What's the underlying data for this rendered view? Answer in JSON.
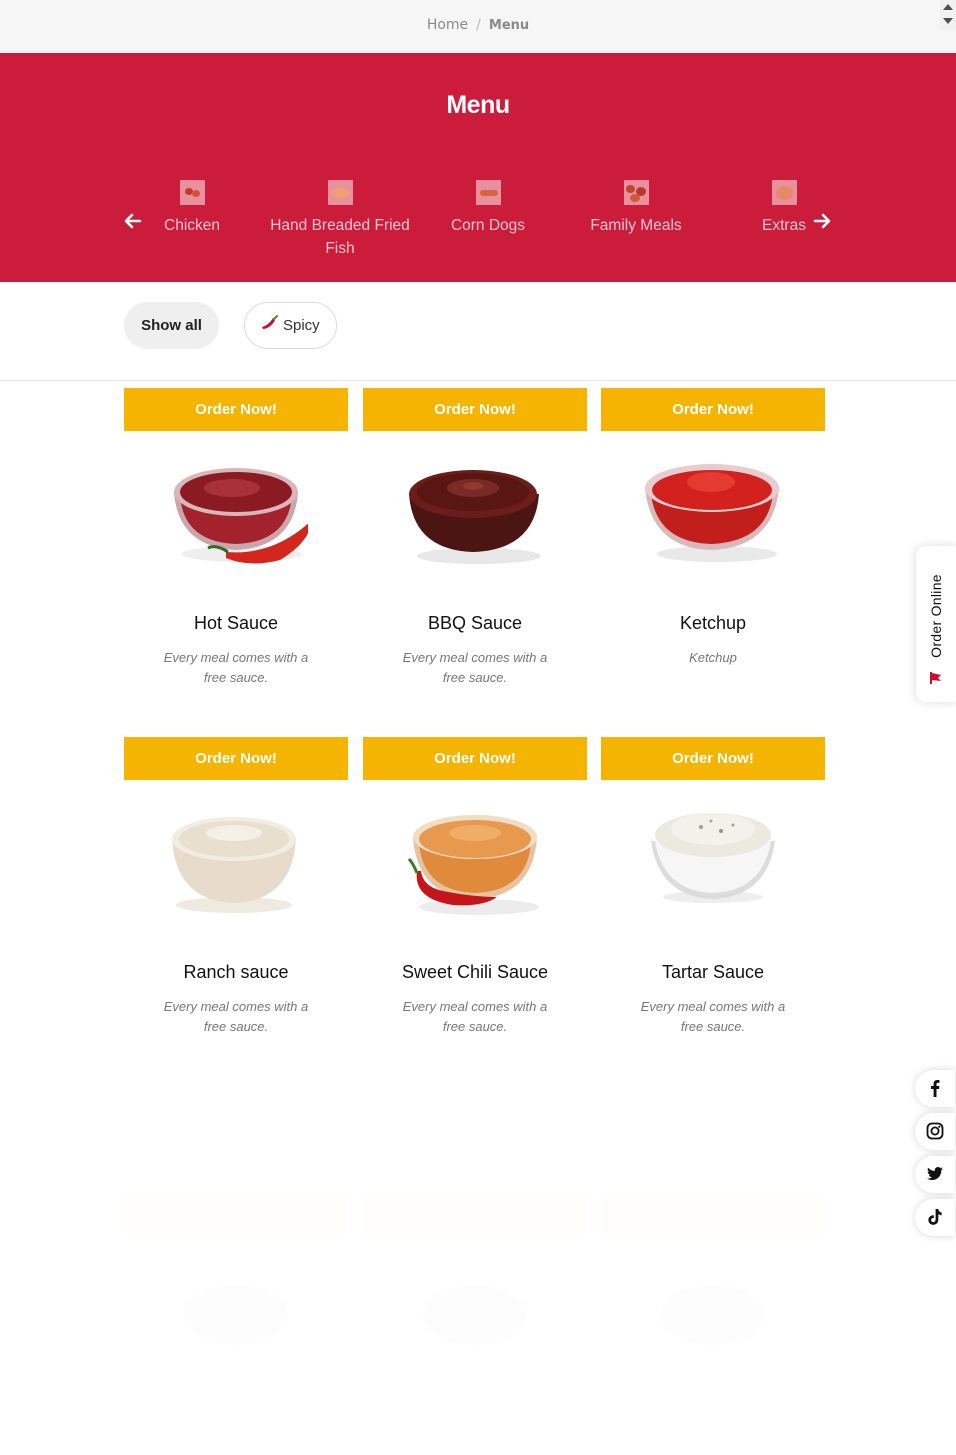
{
  "breadcrumb": {
    "home": "Home",
    "separator": "/",
    "current": "Menu"
  },
  "hero": {
    "title": "Menu",
    "background_color": "#cc1c3c",
    "categories": [
      {
        "label": "Chicken",
        "icon": "chicken-thumbnail"
      },
      {
        "label": "Hand Breaded Fried Fish",
        "icon": "fish-thumbnail"
      },
      {
        "label": "Corn Dogs",
        "icon": "corn-dog-thumbnail"
      },
      {
        "label": "Family Meals",
        "icon": "family-meal-thumbnail"
      },
      {
        "label": "Extras",
        "icon": "extras-thumbnail"
      }
    ]
  },
  "filters": {
    "show_all": "Show all",
    "spicy": "Spicy"
  },
  "accent_color": "#f4b400",
  "products": [
    {
      "order_label": "Order Now!",
      "name": "Hot Sauce",
      "description": "Every meal comes with a free sauce.",
      "image": "hot-sauce-bowl"
    },
    {
      "order_label": "Order Now!",
      "name": "BBQ Sauce",
      "description": "Every meal comes with a free sauce.",
      "image": "bbq-sauce-bowl"
    },
    {
      "order_label": "Order Now!",
      "name": "Ketchup",
      "description": "Ketchup",
      "image": "ketchup-bowl"
    },
    {
      "order_label": "Order Now!",
      "name": "Ranch sauce",
      "description": "Every meal comes with a free sauce.",
      "image": "ranch-sauce-bowl"
    },
    {
      "order_label": "Order Now!",
      "name": "Sweet Chili Sauce",
      "description": "Every meal comes with a free sauce.",
      "image": "sweet-chili-sauce-bowl"
    },
    {
      "order_label": "Order Now!",
      "name": "Tartar Sauce",
      "description": "Every meal comes with a free sauce.",
      "image": "tartar-sauce-bowl"
    }
  ],
  "side_tab": {
    "label": "Order Online"
  },
  "social_icons": [
    "facebook-icon",
    "instagram-icon",
    "twitter-icon",
    "tiktok-icon"
  ]
}
